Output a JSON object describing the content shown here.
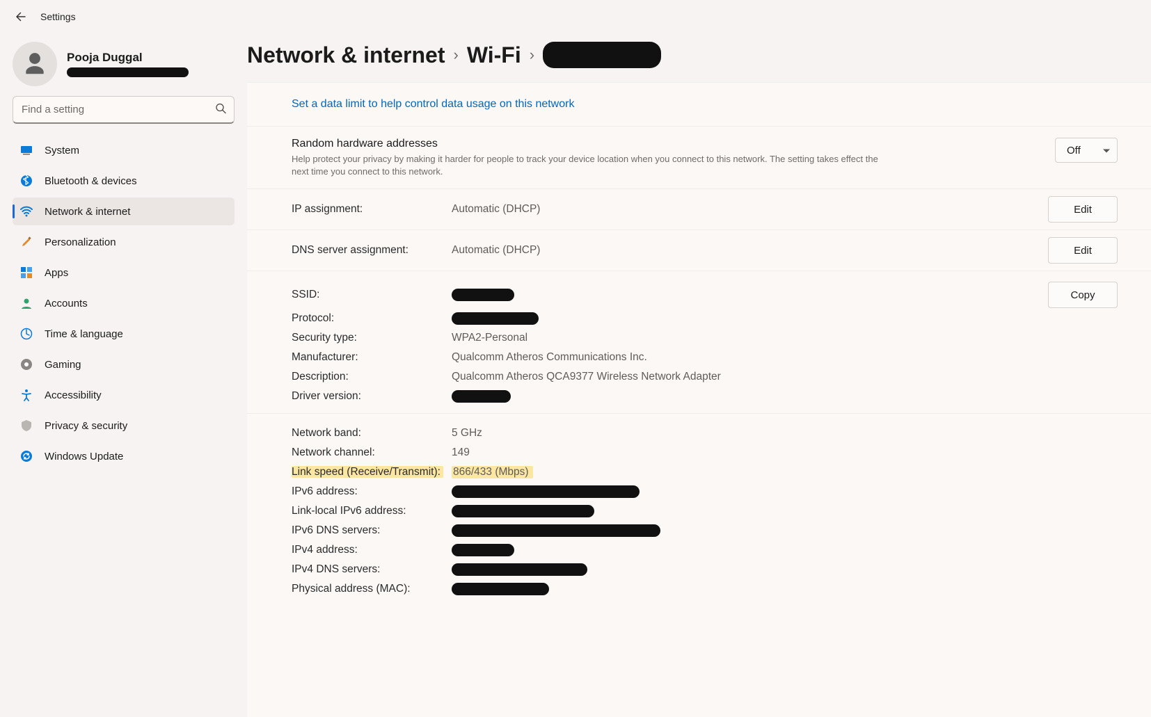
{
  "window": {
    "title": "Settings"
  },
  "profile": {
    "name": "Pooja Duggal"
  },
  "search": {
    "placeholder": "Find a setting"
  },
  "sidebar": {
    "items": [
      {
        "label": "System"
      },
      {
        "label": "Bluetooth & devices"
      },
      {
        "label": "Network & internet"
      },
      {
        "label": "Personalization"
      },
      {
        "label": "Apps"
      },
      {
        "label": "Accounts"
      },
      {
        "label": "Time & language"
      },
      {
        "label": "Gaming"
      },
      {
        "label": "Accessibility"
      },
      {
        "label": "Privacy & security"
      },
      {
        "label": "Windows Update"
      }
    ],
    "active_index": 2
  },
  "breadcrumb": {
    "level1": "Network & internet",
    "level2": "Wi-Fi"
  },
  "panel_link": "Set a data limit to help control data usage on this network",
  "settings": {
    "random_hw": {
      "title": "Random hardware addresses",
      "desc": "Help protect your privacy by making it harder for people to track your device location when you connect to this network. The setting takes effect the next time you connect to this network.",
      "value": "Off"
    },
    "ip_assignment": {
      "label": "IP assignment:",
      "value": "Automatic (DHCP)",
      "button": "Edit"
    },
    "dns_assignment": {
      "label": "DNS server assignment:",
      "value": "Automatic (DHCP)",
      "button": "Edit"
    }
  },
  "details": {
    "copy_button": "Copy",
    "block1": [
      {
        "k": "SSID:",
        "redact_w": 90
      },
      {
        "k": "Protocol:",
        "redact_w": 125
      },
      {
        "k": "Security type:",
        "v": "WPA2-Personal"
      },
      {
        "k": "Manufacturer:",
        "v": "Qualcomm Atheros Communications Inc."
      },
      {
        "k": "Description:",
        "v": "Qualcomm Atheros QCA9377 Wireless Network Adapter"
      },
      {
        "k": "Driver version:",
        "redact_w": 85
      }
    ],
    "block2": [
      {
        "k": "Network band:",
        "v": "5 GHz"
      },
      {
        "k": "Network channel:",
        "v": "149"
      },
      {
        "k": "Link speed (Receive/Transmit):",
        "v": "866/433 (Mbps)",
        "highlight": true
      },
      {
        "k": "IPv6 address:",
        "redact_w": 270
      },
      {
        "k": "Link-local IPv6 address:",
        "redact_w": 205
      },
      {
        "k": "IPv6 DNS servers:",
        "redact_w": 300
      },
      {
        "k": "IPv4 address:",
        "redact_w": 90
      },
      {
        "k": "IPv4 DNS servers:",
        "redact_w": 195
      },
      {
        "k": "Physical address (MAC):",
        "redact_w": 140
      }
    ]
  }
}
